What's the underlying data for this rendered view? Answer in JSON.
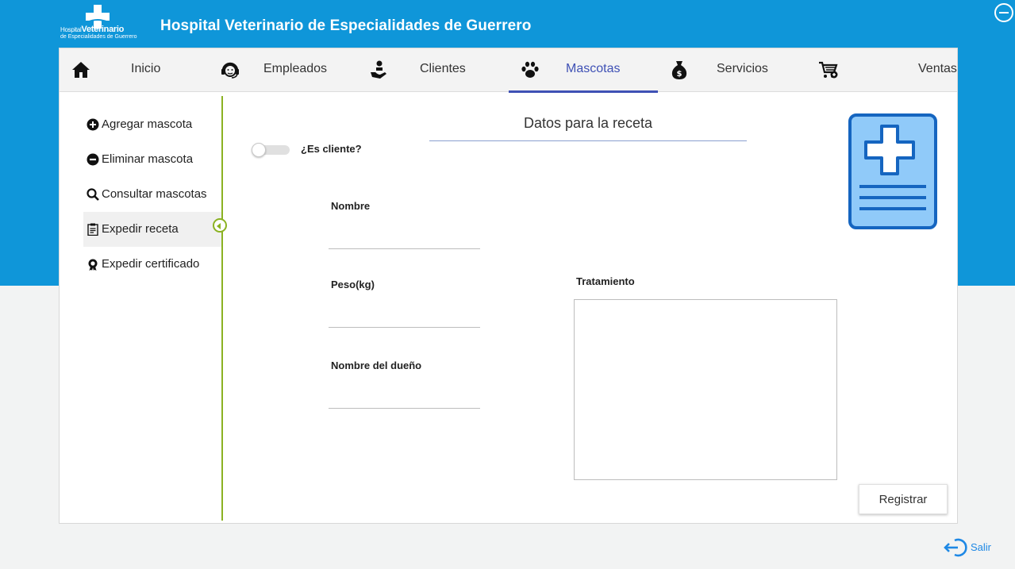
{
  "header": {
    "logo_line1_small": "Hospital",
    "logo_line1_big": "Veterinario",
    "logo_line2": "de Especialidades de Guerrero",
    "title": "Hospital Veterinario de Especialidades de Guerrero"
  },
  "nav": {
    "items": [
      {
        "label": "Inicio",
        "icon": "home-icon"
      },
      {
        "label": "Empleados",
        "icon": "headset-icon"
      },
      {
        "label": "Clientes",
        "icon": "hand-person-icon"
      },
      {
        "label": "Mascotas",
        "icon": "paw-icon"
      },
      {
        "label": "Servicios",
        "icon": "money-bag-icon"
      },
      {
        "label": "Ventas",
        "icon": "cart-icon"
      }
    ],
    "active": "Mascotas"
  },
  "sidebar": {
    "items": [
      {
        "label": "Agregar mascota",
        "icon": "plus-circle-icon"
      },
      {
        "label": "Eliminar mascota",
        "icon": "minus-circle-icon"
      },
      {
        "label": "Consultar mascotas",
        "icon": "search-icon"
      },
      {
        "label": "Expedir receta",
        "icon": "clipboard-icon"
      },
      {
        "label": "Expedir certificado",
        "icon": "award-icon"
      }
    ],
    "active": "Expedir receta"
  },
  "form": {
    "title": "Datos para la receta",
    "toggle_label": "¿Es cliente?",
    "nombre_label": "Nombre",
    "peso_label": "Peso(kg)",
    "dueno_label": "Nombre del dueño",
    "tratamiento_label": "Tratamiento",
    "register_label": "Registrar"
  },
  "footer": {
    "salir_label": "Salir"
  },
  "colors": {
    "header_blue": "#0f96d9",
    "nav_active": "#3f51b5",
    "sidebar_accent": "#8bb222",
    "rx_icon_fill": "#90caf9",
    "rx_icon_stroke": "#1565c0",
    "salir_blue": "#1e88e5"
  }
}
